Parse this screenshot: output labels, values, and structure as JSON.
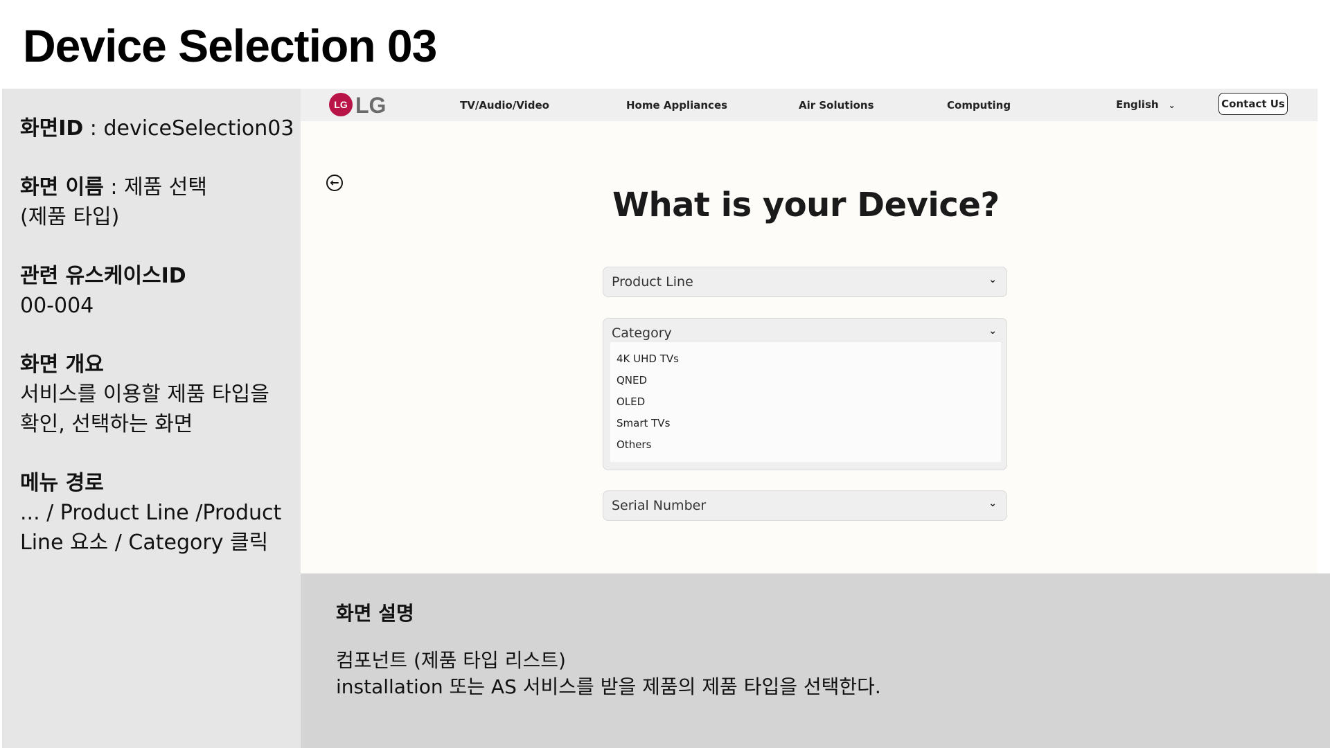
{
  "page": {
    "title": "Device Selection 03"
  },
  "info": {
    "screen_id_label": "화면ID",
    "screen_id_value": " : deviceSelection03",
    "screen_name_label": "화면 이름",
    "screen_name_value": " : 제품 선택\n(제품 타입)",
    "usecase_label": "관련 유스케이스ID",
    "usecase_value": "00-004",
    "overview_label": "화면 개요",
    "overview_value": "서비스를 이용할 제품 타입을\n확인, 선택하는 화면",
    "menu_path_label": "메뉴 경로",
    "menu_path_value": "... / Product Line /Product\nLine 요소 / Category 클릭"
  },
  "site": {
    "logo_text": "LG",
    "logo_mark": "LG",
    "nav": [
      "TV/Audio/Video",
      "Home Appliances",
      "Air Solutions",
      "Computing"
    ],
    "language": "English",
    "contact_label": "Contact Us",
    "question": "What is your Device?",
    "product_line_placeholder": "Product Line",
    "category_label": "Category",
    "category_options": [
      "4K UHD TVs",
      "QNED",
      "OLED",
      "Smart TVs",
      "Others"
    ],
    "serial_placeholder": "Serial Number",
    "icons": {
      "back": "back-arrow-circle-icon",
      "chevron": "chevron-down-icon"
    },
    "colors": {
      "brand": "#b81447",
      "nav_bg": "#efefef",
      "page_bg": "#fdfcf8"
    }
  },
  "description": {
    "title": "화면 설명",
    "line1": "컴포넌트  (제품 타입 리스트)",
    "line2": "installation 또는 AS 서비스를 받을 제품의 제품 타입을 선택한다."
  }
}
